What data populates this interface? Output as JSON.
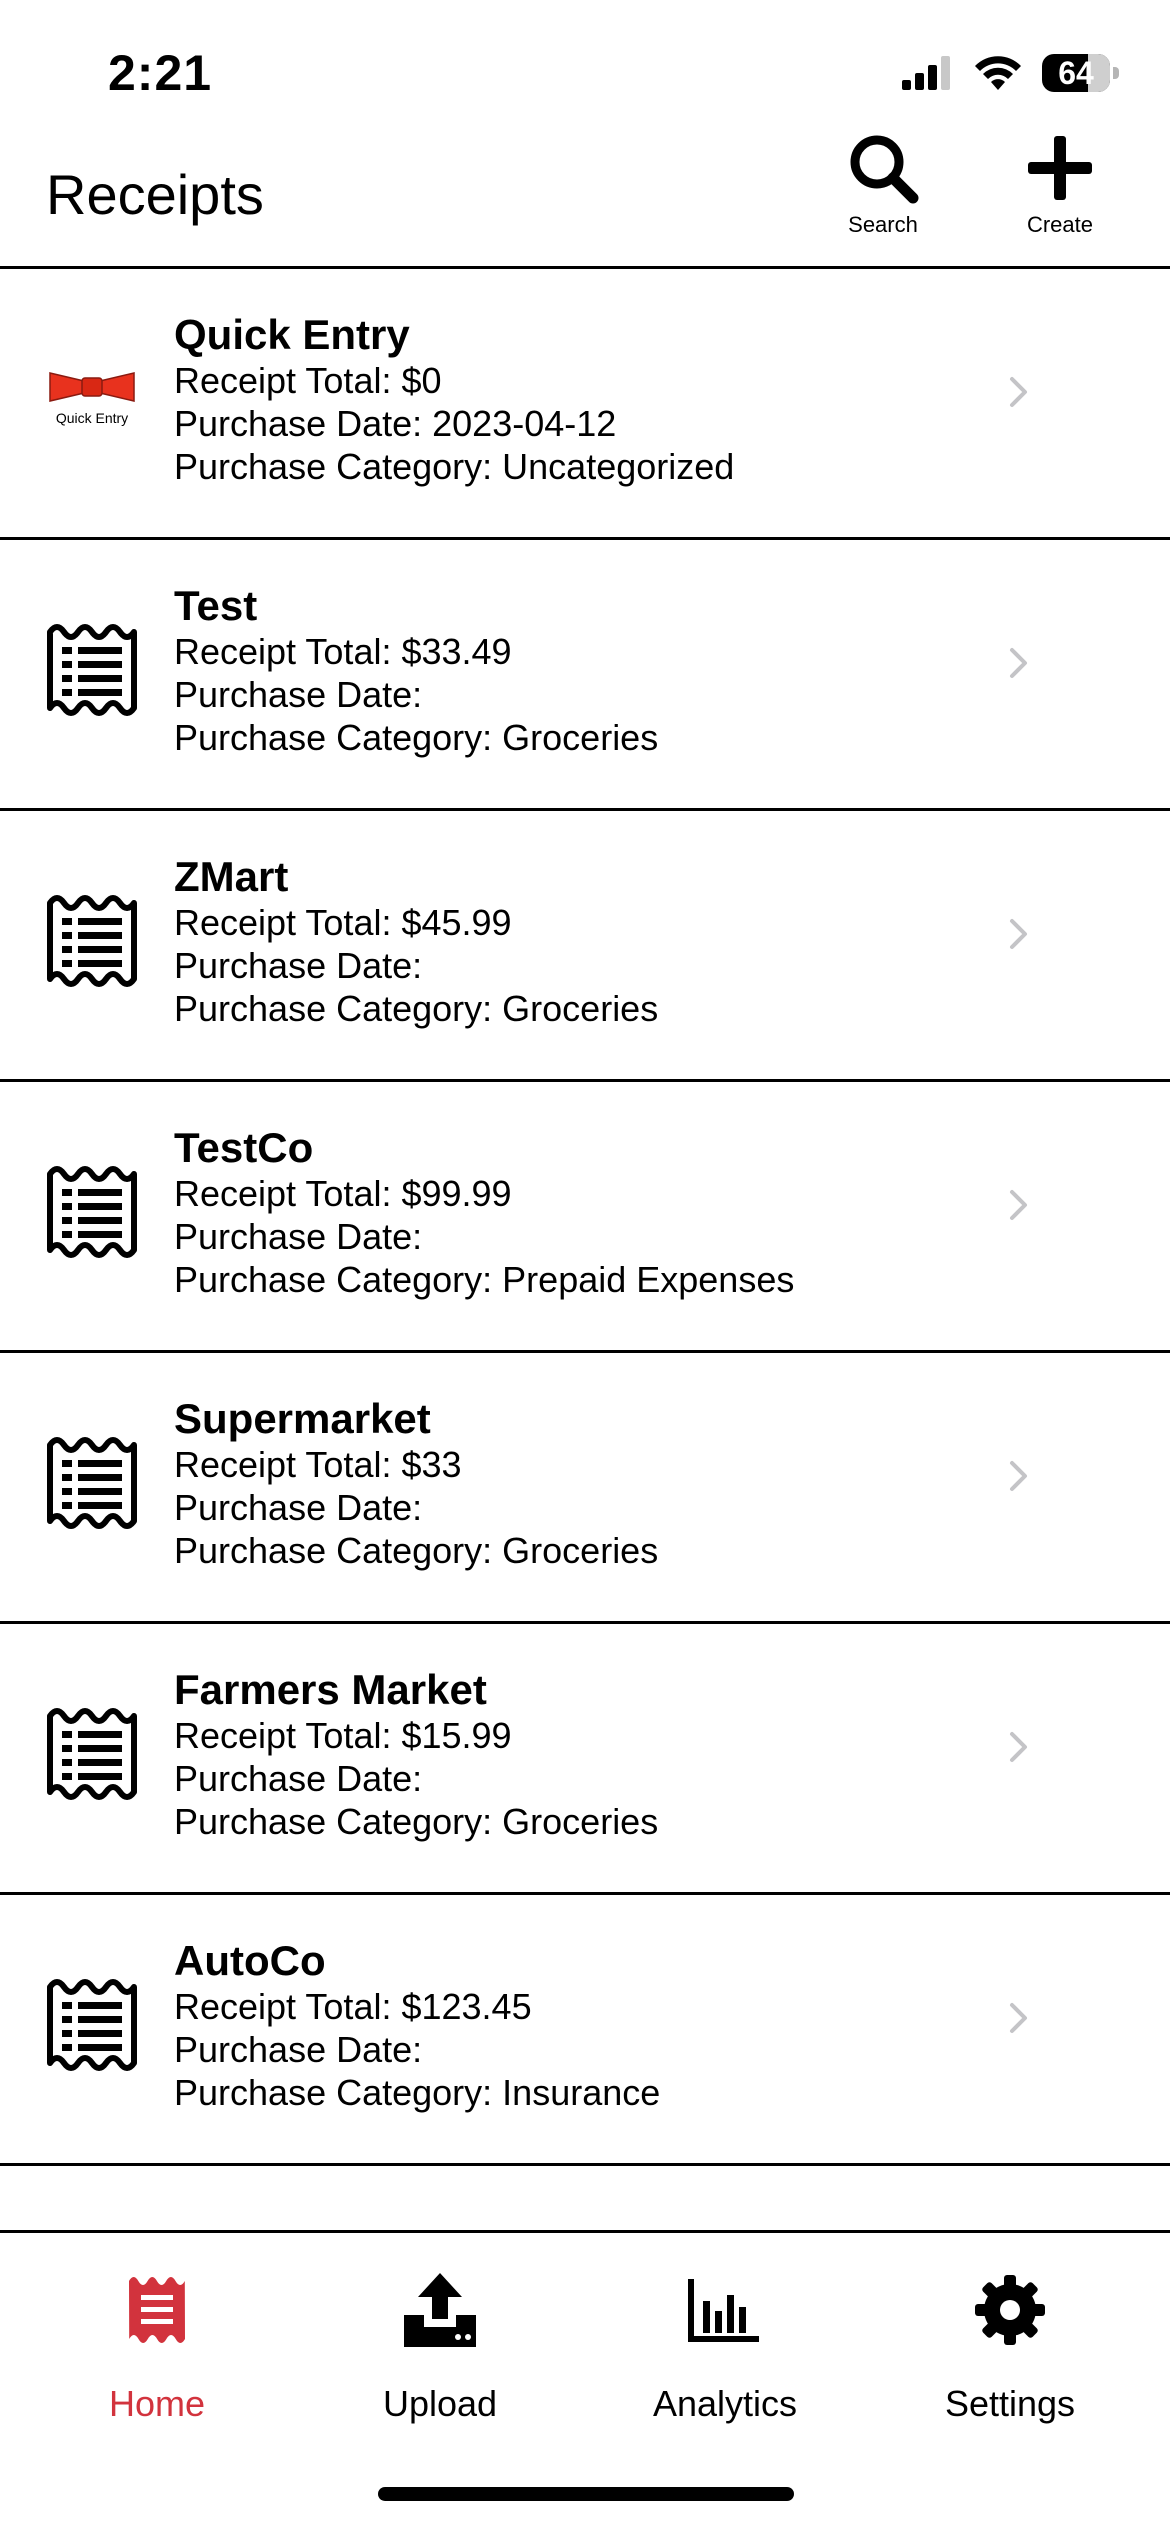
{
  "status_bar": {
    "time": "2:21",
    "battery": "64"
  },
  "header": {
    "title": "Receipts",
    "search_label": "Search",
    "create_label": "Create"
  },
  "receipts": [
    {
      "icon": "quick-entry-bow-logo",
      "icon_text": "Quick Entry",
      "title": "Quick Entry",
      "total": "Receipt Total: $0",
      "date": "Purchase Date: 2023-04-12",
      "category": "Purchase Category: Uncategorized"
    },
    {
      "icon": "receipt-icon",
      "title": "Test",
      "total": "Receipt Total: $33.49",
      "date": "Purchase Date:",
      "category": "Purchase Category: Groceries"
    },
    {
      "icon": "receipt-icon",
      "title": "ZMart",
      "total": "Receipt Total: $45.99",
      "date": "Purchase Date:",
      "category": "Purchase Category: Groceries"
    },
    {
      "icon": "receipt-icon",
      "title": "TestCo",
      "total": "Receipt Total: $99.99",
      "date": "Purchase Date:",
      "category": "Purchase Category: Prepaid Expenses"
    },
    {
      "icon": "receipt-icon",
      "title": "Supermarket",
      "total": "Receipt Total: $33",
      "date": "Purchase Date:",
      "category": "Purchase Category: Groceries"
    },
    {
      "icon": "receipt-icon",
      "title": "Farmers Market",
      "total": "Receipt Total: $15.99",
      "date": "Purchase Date:",
      "category": "Purchase Category: Groceries"
    },
    {
      "icon": "receipt-icon",
      "title": "AutoCo",
      "total": "Receipt Total: $123.45",
      "date": "Purchase Date:",
      "category": "Purchase Category: Insurance"
    }
  ],
  "tabs": [
    {
      "label": "Home",
      "icon": "receipt-icon",
      "active": true
    },
    {
      "label": "Upload",
      "icon": "upload-icon",
      "active": false
    },
    {
      "label": "Analytics",
      "icon": "bar-chart-icon",
      "active": false
    },
    {
      "label": "Settings",
      "icon": "gear-icon",
      "active": false
    }
  ],
  "colors": {
    "accent": "#d2333d",
    "divider": "#000000",
    "chevron": "#c4c4c7",
    "quick_entry_bow": "#e8321e"
  }
}
